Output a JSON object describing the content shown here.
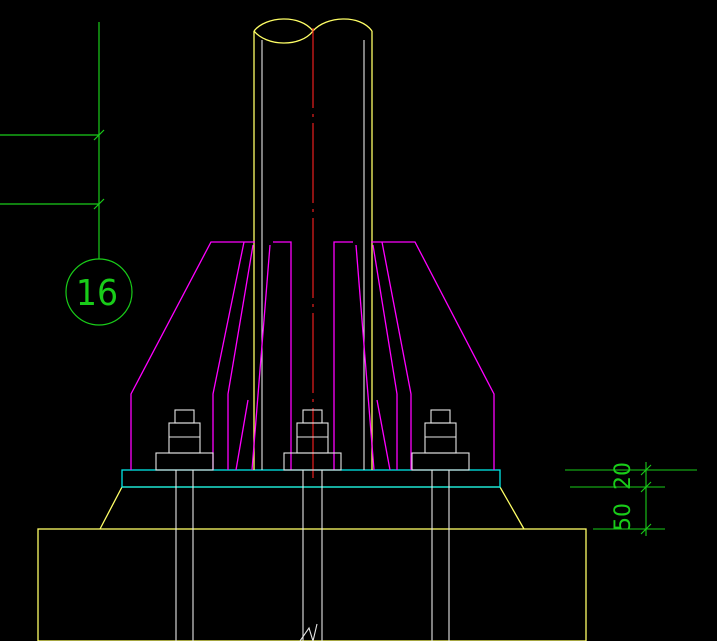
{
  "drawing": {
    "axis_bubble_label": "16",
    "dim_upper": "50",
    "dim_lower": "20"
  },
  "colors": {
    "background": "#000000",
    "yellow": "#ffff66",
    "white": "#e6e6e6",
    "magenta": "#ff00ff",
    "red": "#ff2020",
    "green": "#19cc19",
    "cyan": "#00e6e6"
  }
}
